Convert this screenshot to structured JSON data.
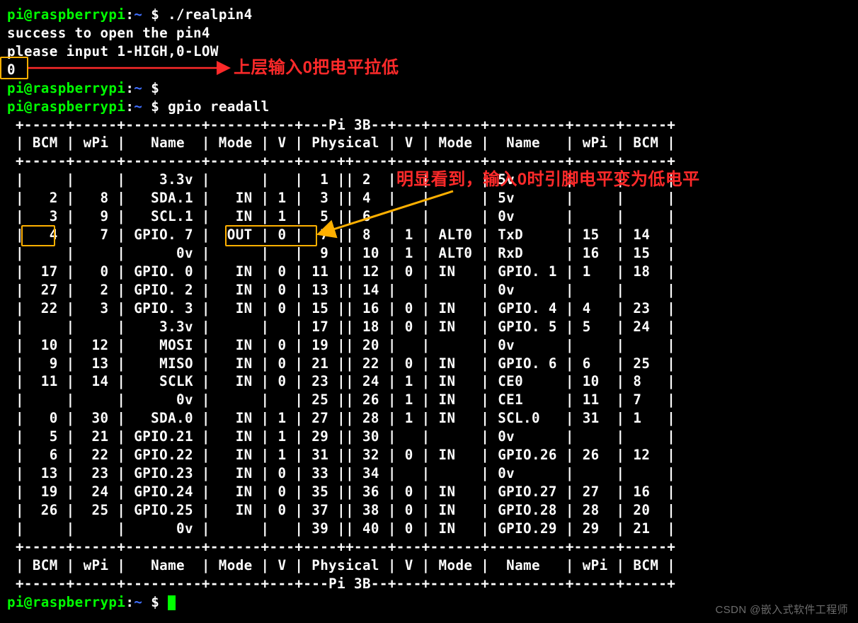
{
  "prompt": {
    "user": "pi",
    "host": "raspberrypi",
    "path": "~",
    "sep": "$"
  },
  "cmd1": "./realpin4",
  "out1_line1": "success to open the pin4",
  "out1_line2": "please input 1-HIGH,0-LOW",
  "out1_input": "0",
  "cmd2": "gpio readall",
  "anno1": "上层输入0把电平拉低",
  "anno2": "明显看到，输入0时引脚电平变为低电平",
  "watermark": "CSDN @嵌入式软件工程师",
  "table": {
    "title": "Pi 3B",
    "divtop": " +-----+-----+---------+------+---+---Pi 3B--+---+------+---------+-----+-----+",
    "header": " | BCM | wPi |   Name  | Mode | V | Physical | V | Mode |  Name   | wPi | BCM |",
    "divmid": " +-----+-----+---------+------+---+----++----+---+------+---------+-----+-----+",
    "footer": " | BCM | wPi |   Name  | Mode | V | Physical | V | Mode |  Name   | wPi | BCM |",
    "divbot": " +-----+-----+---------+------+---+---Pi 3B--+---+------+---------+-----+-----+",
    "rows": [
      " |     |     |    3.3v |      |   |  1 || 2  |   |      | 5v      |     |     |",
      " |   2 |   8 |   SDA.1 |   IN | 1 |  3 || 4  |   |      | 5v      |     |     |",
      " |   3 |   9 |   SCL.1 |   IN | 1 |  5 || 6  |   |      | 0v      |     |     |",
      " |   4 |   7 | GPIO. 7 |  OUT | 0 |  7 || 8  | 1 | ALT0 | TxD     | 15  | 14  |",
      " |     |     |      0v |      |   |  9 || 10 | 1 | ALT0 | RxD     | 16  | 15  |",
      " |  17 |   0 | GPIO. 0 |   IN | 0 | 11 || 12 | 0 | IN   | GPIO. 1 | 1   | 18  |",
      " |  27 |   2 | GPIO. 2 |   IN | 0 | 13 || 14 |   |      | 0v      |     |     |",
      " |  22 |   3 | GPIO. 3 |   IN | 0 | 15 || 16 | 0 | IN   | GPIO. 4 | 4   | 23  |",
      " |     |     |    3.3v |      |   | 17 || 18 | 0 | IN   | GPIO. 5 | 5   | 24  |",
      " |  10 |  12 |    MOSI |   IN | 0 | 19 || 20 |   |      | 0v      |     |     |",
      " |   9 |  13 |    MISO |   IN | 0 | 21 || 22 | 0 | IN   | GPIO. 6 | 6   | 25  |",
      " |  11 |  14 |    SCLK |   IN | 0 | 23 || 24 | 1 | IN   | CE0     | 10  | 8   |",
      " |     |     |      0v |      |   | 25 || 26 | 1 | IN   | CE1     | 11  | 7   |",
      " |   0 |  30 |   SDA.0 |   IN | 1 | 27 || 28 | 1 | IN   | SCL.0   | 31  | 1   |",
      " |   5 |  21 | GPIO.21 |   IN | 1 | 29 || 30 |   |      | 0v      |     |     |",
      " |   6 |  22 | GPIO.22 |   IN | 1 | 31 || 32 | 0 | IN   | GPIO.26 | 26  | 12  |",
      " |  13 |  23 | GPIO.23 |   IN | 0 | 33 || 34 |   |      | 0v      |     |     |",
      " |  19 |  24 | GPIO.24 |   IN | 0 | 35 || 36 | 0 | IN   | GPIO.27 | 27  | 16  |",
      " |  26 |  25 | GPIO.25 |   IN | 0 | 37 || 38 | 0 | IN   | GPIO.28 | 28  | 20  |",
      " |     |     |      0v |      |   | 39 || 40 | 0 | IN   | GPIO.29 | 29  | 21  |"
    ]
  }
}
